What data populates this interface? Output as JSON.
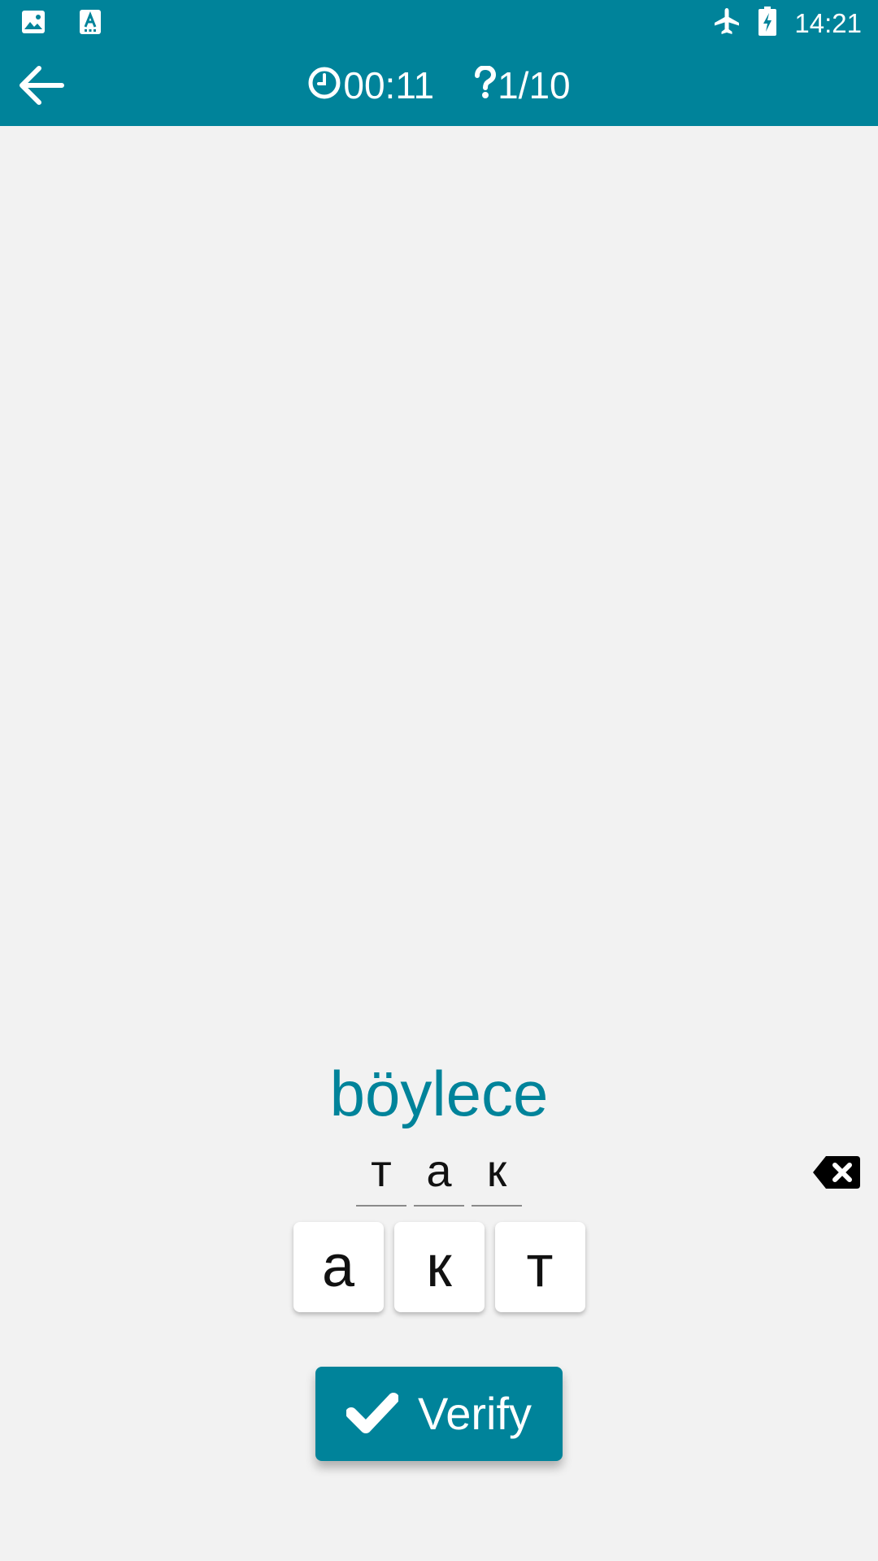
{
  "colors": {
    "accent": "#00839a",
    "background": "#f2f2f2",
    "text_dark": "#111111",
    "on_accent": "#ffffff"
  },
  "status_bar": {
    "time": "14:21",
    "icons": [
      "image-icon",
      "text-format-icon",
      "airplane-icon",
      "battery-charging-icon"
    ]
  },
  "app_bar": {
    "back_icon": "arrow-back-icon",
    "timer": "00:11",
    "timer_icon": "clock-icon",
    "progress": "1/10",
    "progress_icon": "question-icon"
  },
  "quiz": {
    "word": "böylece",
    "answer_letters": [
      "т",
      "а",
      "к"
    ],
    "tile_letters": [
      "а",
      "к",
      "т"
    ],
    "backspace_icon": "backspace-icon"
  },
  "verify_button": {
    "label": "Verify",
    "icon": "check-icon"
  }
}
